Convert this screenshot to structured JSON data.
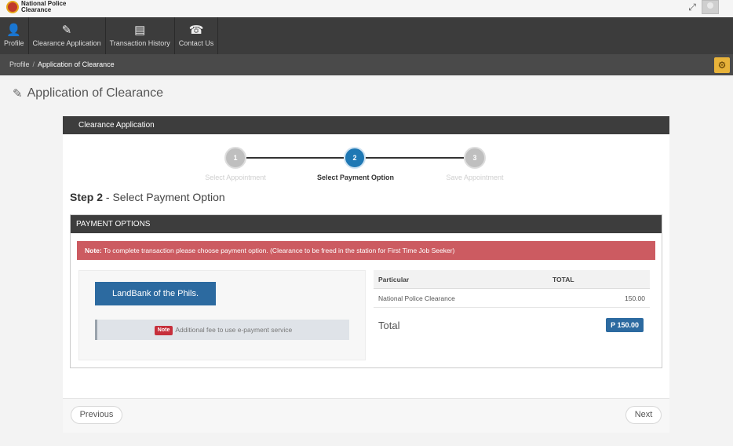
{
  "header": {
    "brand_line1": "National Police",
    "brand_line2": "Clearance",
    "fullscreen_icon": "expand-icon",
    "avatar_icon": "user-avatar-icon"
  },
  "nav": {
    "items": [
      {
        "label": "Profile",
        "icon": "user-icon"
      },
      {
        "label": "Clearance Application",
        "icon": "edit-icon"
      },
      {
        "label": "Transaction History",
        "icon": "list-icon"
      },
      {
        "label": "Contact Us",
        "icon": "phone-icon"
      }
    ]
  },
  "breadcrumb": {
    "items": [
      "Profile",
      "Application of Clearance"
    ],
    "separator": "/"
  },
  "page": {
    "title": "Application of Clearance",
    "title_icon": "edit-icon"
  },
  "panel": {
    "title": "Clearance Application"
  },
  "stepper": {
    "steps": [
      {
        "number": "1",
        "label": "Select Appointment",
        "state": "inactive"
      },
      {
        "number": "2",
        "label": "Select Payment Option",
        "state": "active"
      },
      {
        "number": "3",
        "label": "Save Appointment",
        "state": "inactive"
      }
    ]
  },
  "step_heading": {
    "prefix": "Step 2",
    "text": " - Select Payment Option"
  },
  "payment": {
    "header": "PAYMENT OPTIONS",
    "note_label": "Note:",
    "note_text": " To complete transaction please choose payment option. (Clearance to be freed in the station for First Time Job Seeker)",
    "bank_button": "LandBank of the Phils.",
    "fee_badge": "Note",
    "fee_text": "Additional fee to use e-payment service"
  },
  "summary": {
    "col_particular": "Particular",
    "col_total": "TOTAL",
    "rows": [
      {
        "particular": "National Police Clearance",
        "amount": "150.00"
      }
    ],
    "total_label": "Total",
    "total_value": "P 150.00"
  },
  "footer": {
    "previous": "Previous",
    "next": "Next"
  },
  "colors": {
    "nav_bg": "#3c3c3c",
    "accent_blue": "#2c6aa0",
    "alert_red": "#cc5b61",
    "settings_gold": "#e8b33a"
  }
}
